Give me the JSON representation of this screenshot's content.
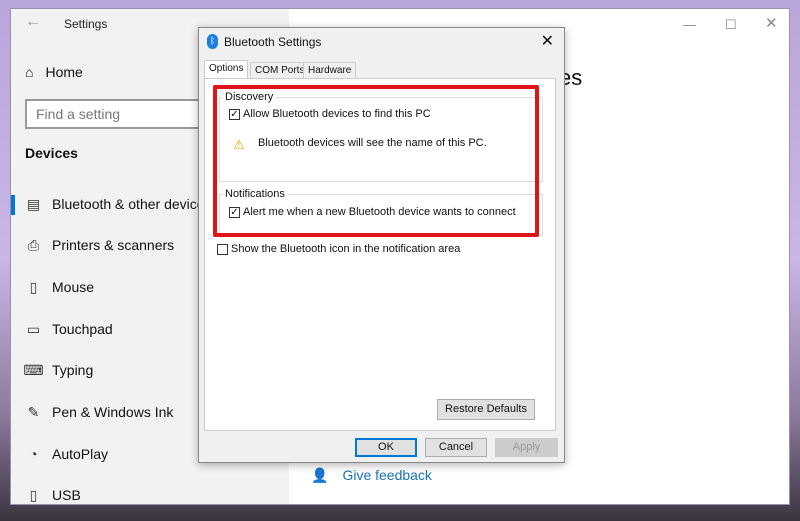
{
  "settings": {
    "title": "Settings",
    "home": "Home",
    "search_placeholder": "Find a setting",
    "section": "Devices",
    "page_title_fragment": "es",
    "items": [
      {
        "label": "Bluetooth & other devices",
        "icon": "bluetooth-devices-icon"
      },
      {
        "label": "Printers & scanners",
        "icon": "printer-icon"
      },
      {
        "label": "Mouse",
        "icon": "mouse-icon"
      },
      {
        "label": "Touchpad",
        "icon": "touchpad-icon"
      },
      {
        "label": "Typing",
        "icon": "keyboard-icon"
      },
      {
        "label": "Pen & Windows Ink",
        "icon": "pen-icon"
      },
      {
        "label": "AutoPlay",
        "icon": "autoplay-icon"
      },
      {
        "label": "USB",
        "icon": "usb-icon"
      }
    ],
    "feedback": "Give feedback"
  },
  "dialog": {
    "title": "Bluetooth Settings",
    "tabs": [
      "Options",
      "COM Ports",
      "Hardware"
    ],
    "discovery": {
      "label": "Discovery",
      "allow": "Allow Bluetooth devices to find this PC",
      "allow_checked": true,
      "warning": "Bluetooth devices will see the name of this PC."
    },
    "notifications": {
      "label": "Notifications",
      "alert": "Alert me when a new Bluetooth device wants to connect",
      "alert_checked": true
    },
    "show_icon": "Show the Bluetooth icon in the notification area",
    "show_icon_checked": false,
    "restore": "Restore Defaults",
    "ok": "OK",
    "cancel": "Cancel",
    "apply": "Apply"
  },
  "colors": {
    "highlight": "#e0121a",
    "accent": "#0078d7",
    "link": "#1a70b8"
  }
}
